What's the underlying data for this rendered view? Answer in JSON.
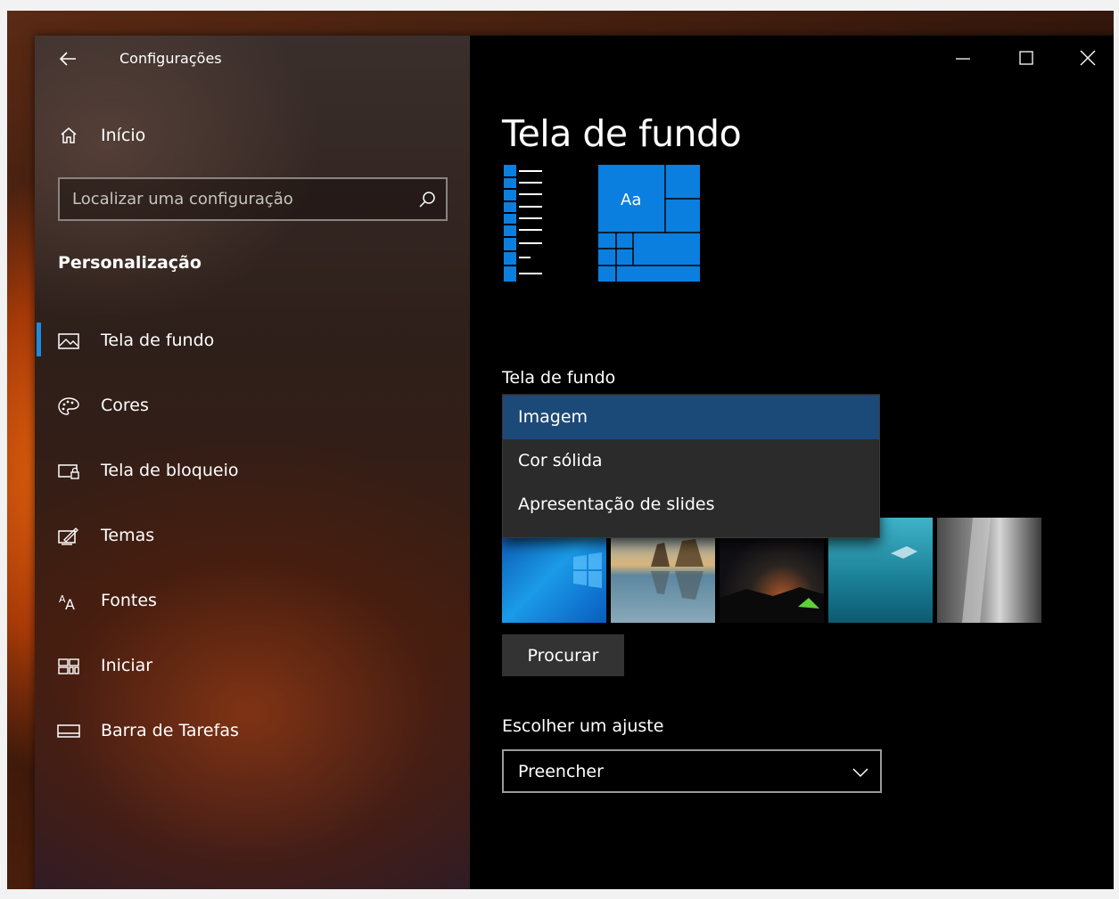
{
  "window": {
    "title": "Configurações",
    "controls": [
      "minimize",
      "maximize",
      "close"
    ]
  },
  "sidebar": {
    "home_label": "Início",
    "search_placeholder": "Localizar uma configuração",
    "section_title": "Personalização",
    "items": [
      {
        "label": "Tela de fundo",
        "icon": "picture-icon",
        "selected": true
      },
      {
        "label": "Cores",
        "icon": "palette-icon",
        "selected": false
      },
      {
        "label": "Tela de bloqueio",
        "icon": "lock-screen-icon",
        "selected": false
      },
      {
        "label": "Temas",
        "icon": "themes-icon",
        "selected": false
      },
      {
        "label": "Fontes",
        "icon": "fonts-icon",
        "selected": false
      },
      {
        "label": "Iniciar",
        "icon": "start-icon",
        "selected": false
      },
      {
        "label": "Barra de Tarefas",
        "icon": "taskbar-icon",
        "selected": false
      }
    ],
    "accent_color": "#1f8bde"
  },
  "main": {
    "title": "Tela de fundo",
    "preview_sample_text": "Aa",
    "background_label": "Tela de fundo",
    "background_options": [
      "Imagem",
      "Cor sólida",
      "Apresentação de slides"
    ],
    "background_selected": "Imagem",
    "browse_label": "Procurar",
    "fit_label": "Escolher um ajuste",
    "fit_value": "Preencher",
    "accent_color": "#0078d7"
  }
}
